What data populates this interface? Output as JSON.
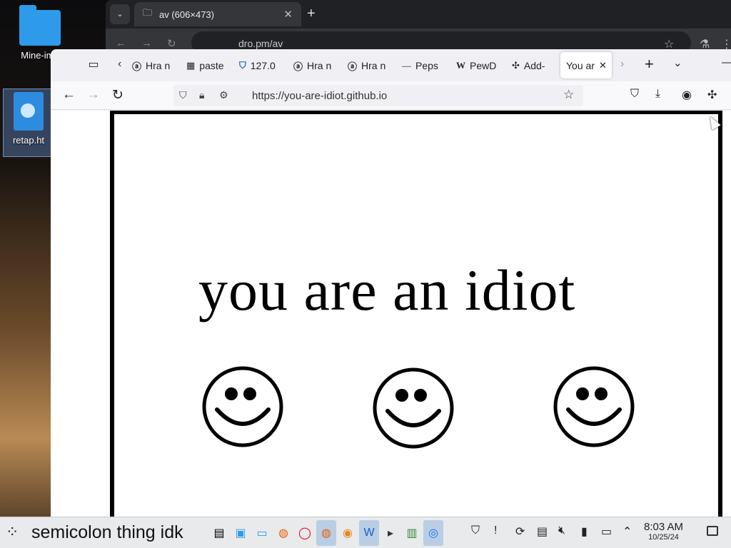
{
  "desktop": {
    "icons": [
      {
        "label": "Mine-ima"
      },
      {
        "label": "retap.ht"
      }
    ]
  },
  "chrome_back": {
    "tab_title": "av (606×473)",
    "url": "dro.pm/av"
  },
  "firefox": {
    "tabs": [
      {
        "label": "Hra n",
        "icon": "site-icon"
      },
      {
        "label": "paste",
        "icon": "paste-icon"
      },
      {
        "label": "127.0",
        "icon": "shield-icon"
      },
      {
        "label": "Hra n",
        "icon": "site-icon"
      },
      {
        "label": "Hra n",
        "icon": "site-icon"
      },
      {
        "label": "Peps",
        "icon": "site-icon"
      },
      {
        "label": "PewD",
        "icon": "wikipedia-icon"
      },
      {
        "label": "Add-",
        "icon": "puzzle-icon"
      },
      {
        "label": "You ar",
        "icon": "",
        "active": true
      }
    ],
    "url": "https://you-are-idiot.github.io"
  },
  "page": {
    "headline": "you are an idiot"
  },
  "taskbar": {
    "launcher_label": "semicolon thing idk",
    "time": "8:03 AM",
    "date": "10/25/24"
  },
  "colors": {
    "accent": "#2e9bea",
    "taskbar_bg": "#e8eaec",
    "chrome_dark": "#202124"
  }
}
